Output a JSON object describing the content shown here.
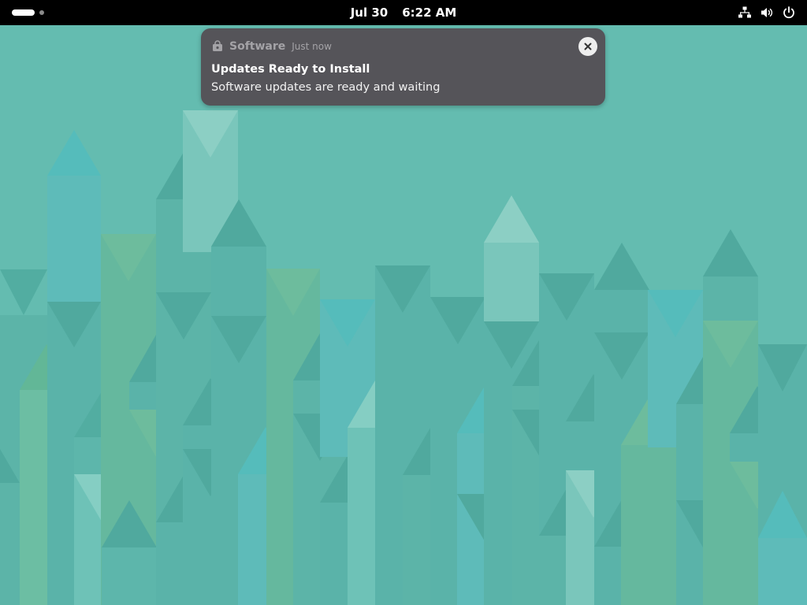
{
  "topbar": {
    "date": "Jul 30",
    "time": "6:22 AM",
    "icons": [
      "network-wired-icon",
      "volume-icon",
      "power-icon"
    ]
  },
  "notification": {
    "app_name": "Software",
    "app_icon": "software-bag-icon",
    "time": "Just now",
    "title": "Updates Ready to Install",
    "body": "Software updates are ready and waiting",
    "close_icon": "close-icon"
  },
  "colors": {
    "topbar": "#000000",
    "wallpaper": "#64bcb0",
    "notification_bg": "#555459"
  }
}
